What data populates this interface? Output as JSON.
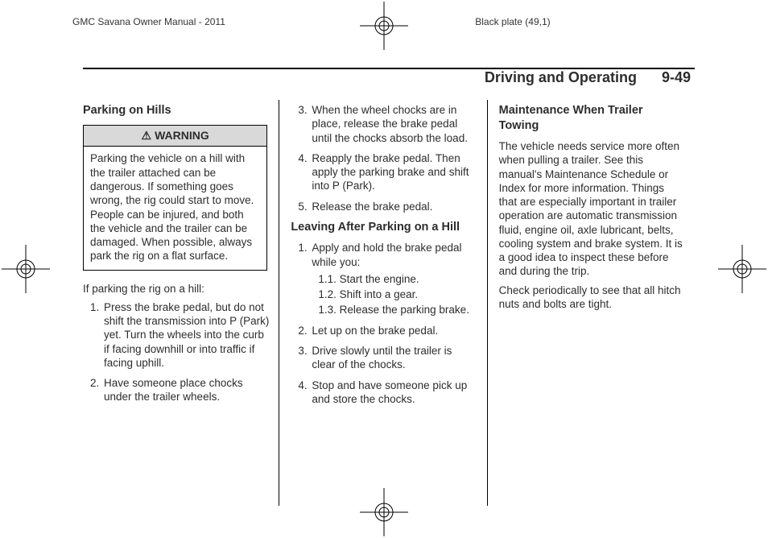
{
  "meta": {
    "manual": "GMC Savana Owner Manual - 2011",
    "plate": "Black plate (49,1)"
  },
  "header": {
    "section": "Driving and Operating",
    "page_number": "9-49"
  },
  "col1": {
    "heading": "Parking on Hills",
    "warning_label": "WARNING",
    "warning_text": "Parking the vehicle on a hill with the trailer attached can be dangerous. If something goes wrong, the rig could start to move. People can be injured, and both the vehicle and the trailer can be damaged. When possible, always park the rig on a flat surface.",
    "intro": "If parking the rig on a hill:",
    "steps": [
      "Press the brake pedal, but do not shift the transmission into P (Park) yet. Turn the wheels into the curb if facing downhill or into traffic if facing uphill.",
      "Have someone place chocks under the trailer wheels."
    ]
  },
  "col2": {
    "steps_continued": [
      "When the wheel chocks are in place, release the brake pedal until the chocks absorb the load.",
      "Reapply the brake pedal. Then apply the parking brake and shift into P (Park).",
      "Release the brake pedal."
    ],
    "heading2": "Leaving After Parking on a Hill",
    "leave_step1": "Apply and hold the brake pedal while you:",
    "leave_sub": [
      "1.1.  Start the engine.",
      "1.2.  Shift into a gear.",
      "1.3.  Release the parking brake."
    ],
    "leave_rest": [
      "Let up on the brake pedal.",
      "Drive slowly until the trailer is clear of the chocks.",
      "Stop and have someone pick up and store the chocks."
    ]
  },
  "col3": {
    "heading": "Maintenance When Trailer Towing",
    "p1": "The vehicle needs service more often when pulling a trailer. See this manual's Maintenance Schedule or Index for more information. Things that are especially important in trailer operation are automatic transmission fluid, engine oil, axle lubricant, belts, cooling system and brake system. It is a good idea to inspect these before and during the trip.",
    "p2": "Check periodically to see that all hitch nuts and bolts are tight."
  }
}
